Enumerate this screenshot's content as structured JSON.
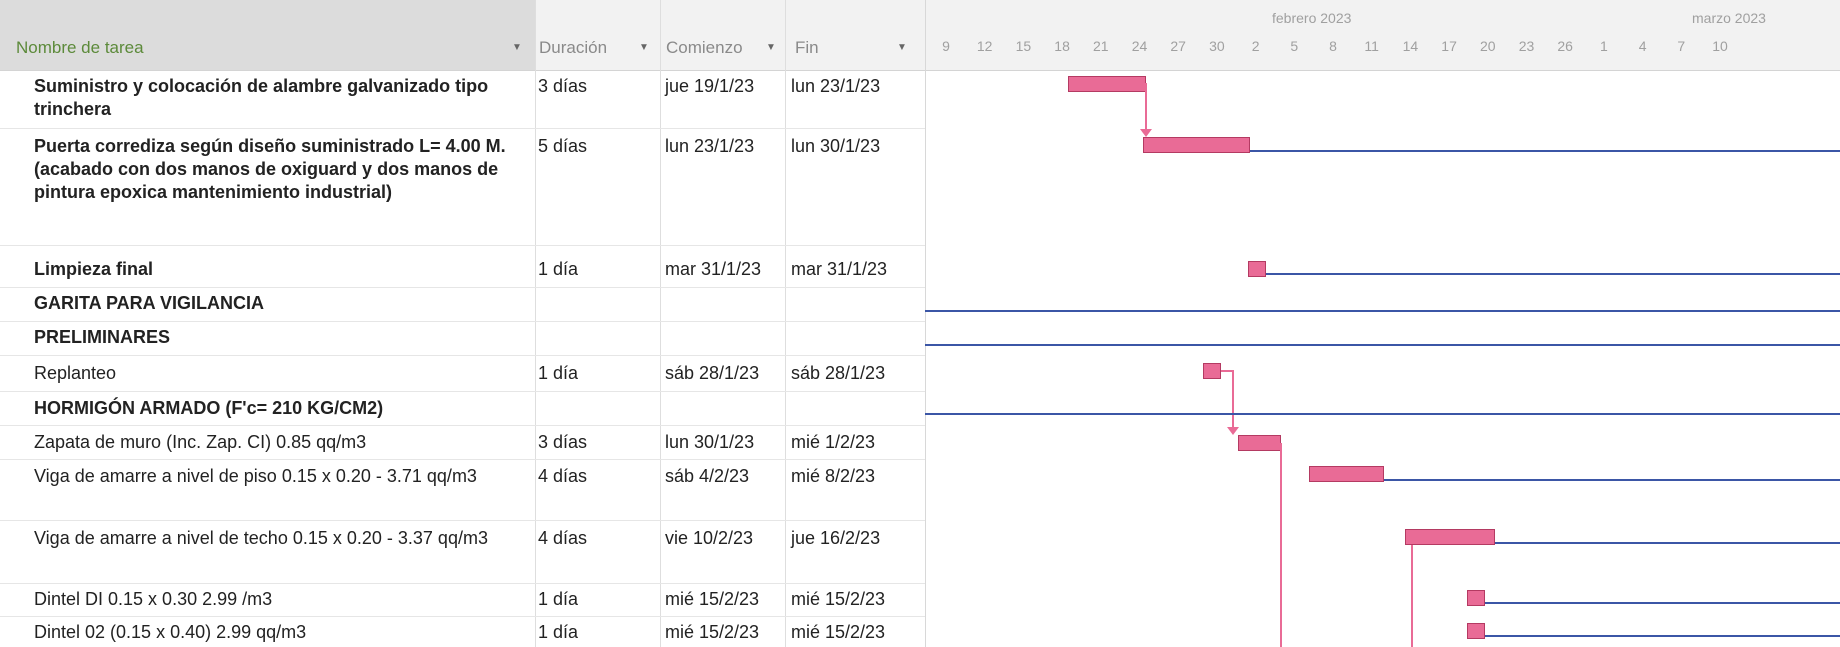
{
  "columns": {
    "task": "Nombre de tarea",
    "duration": "Duración",
    "start": "Comienzo",
    "end": "Fin"
  },
  "timeline": {
    "months": [
      "febrero 2023",
      "marzo 2023"
    ],
    "ticks": [
      "9",
      "12",
      "15",
      "18",
      "21",
      "24",
      "27",
      "30",
      "2",
      "5",
      "8",
      "11",
      "14",
      "17",
      "20",
      "23",
      "26",
      "1",
      "4",
      "7",
      "10"
    ]
  },
  "tasks": [
    {
      "name": "Suministro y colocación de alambre galvanizado tipo trinchera",
      "duration": "3 días",
      "start": "jue 19/1/23",
      "end": "lun 23/1/23",
      "bold": true
    },
    {
      "name": "Puerta corrediza según diseño suministrado L= 4.00 M. (acabado con dos manos de oxiguard y dos manos de pintura epoxica mantenimiento industrial)",
      "duration": "5 días",
      "start": "lun 23/1/23",
      "end": "lun 30/1/23",
      "bold": true
    },
    {
      "name": "Limpieza final",
      "duration": "1 día",
      "start": "mar 31/1/23",
      "end": "mar 31/1/23",
      "bold": true
    },
    {
      "name": "GARITA PARA VIGILANCIA",
      "duration": "",
      "start": "",
      "end": "",
      "bold": true
    },
    {
      "name": "PRELIMINARES",
      "duration": "",
      "start": "",
      "end": "",
      "bold": true
    },
    {
      "name": "Replanteo",
      "duration": "1 día",
      "start": "sáb 28/1/23",
      "end": "sáb 28/1/23",
      "bold": false
    },
    {
      "name": "HORMIGÓN ARMADO (F'c= 210 KG/CM2)",
      "duration": "",
      "start": "",
      "end": "",
      "bold": true
    },
    {
      "name": "Zapata de muro (Inc. Zap. CI) 0.85 qq/m3",
      "duration": "3 días",
      "start": "lun 30/1/23",
      "end": "mié 1/2/23",
      "bold": false
    },
    {
      "name": "Viga de amarre a nivel de piso 0.15 x 0.20 - 3.71 qq/m3",
      "duration": "4 días",
      "start": "sáb 4/2/23",
      "end": "mié 8/2/23",
      "bold": false
    },
    {
      "name": "Viga de amarre a nivel de techo 0.15 x 0.20 - 3.37 qq/m3",
      "duration": "4 días",
      "start": "vie 10/2/23",
      "end": "jue 16/2/23",
      "bold": false
    },
    {
      "name": "Dintel DI 0.15 x 0.30 2.99 /m3",
      "duration": "1 día",
      "start": "mié 15/2/23",
      "end": "mié 15/2/23",
      "bold": false
    },
    {
      "name": "Dintel 02 (0.15 x 0.40) 2.99 qq/m3",
      "duration": "1 día",
      "start": "mié 15/2/23",
      "end": "mié 15/2/23",
      "bold": false
    }
  ],
  "colors": {
    "bar": "#e96b96",
    "summary_line": "#3b56a6",
    "header_task": "#5c8a3a"
  }
}
